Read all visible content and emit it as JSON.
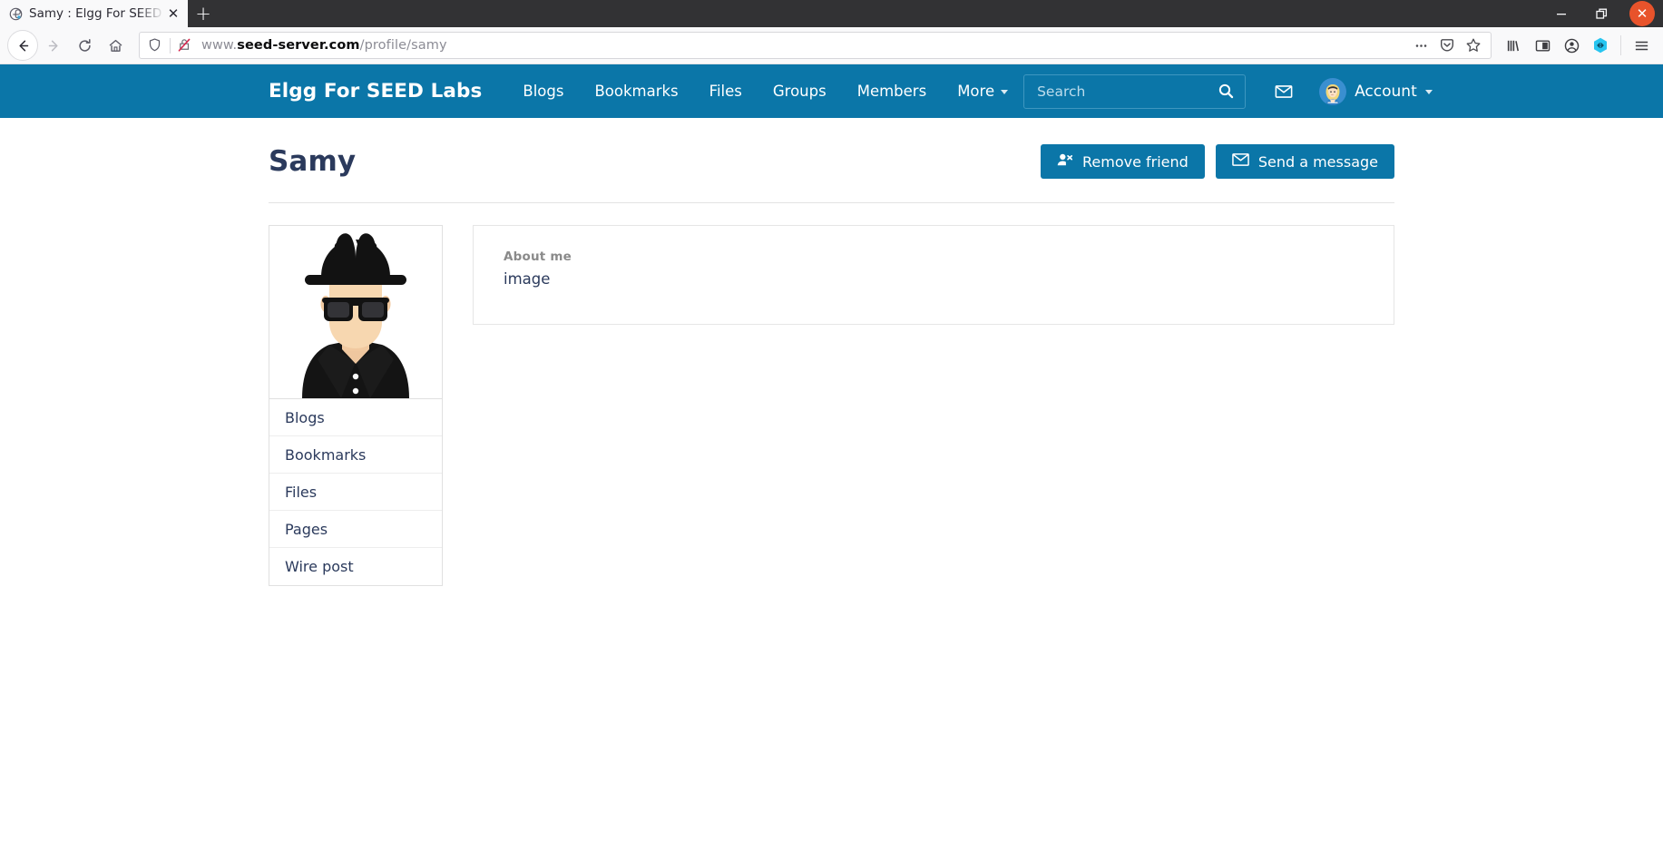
{
  "browser": {
    "tab": {
      "title": "Samy : Elgg For SEED Lab",
      "favicon_name": "elgg-favicon",
      "close_label": "✕"
    },
    "newtab_label": "+",
    "window_controls": {
      "minimize": "—",
      "maximize": "❐",
      "close": "✕"
    },
    "nav": {
      "back": "back-arrow",
      "forward": "forward-arrow",
      "reload": "reload",
      "home": "home"
    },
    "url": {
      "prefix": "www.",
      "domain": "seed-server.com",
      "path": "/profile/samy",
      "full": "www.seed-server.com/profile/samy"
    },
    "url_icons": [
      "page-actions-ellipsis",
      "pocket-save",
      "bookmark-star"
    ],
    "toolbar_icons": [
      "library",
      "sidebar",
      "account-circle",
      "container-extension",
      "app-menu"
    ]
  },
  "site": {
    "brand": "Elgg For SEED Labs",
    "nav_items": [
      {
        "label": "Blogs",
        "has_caret": false
      },
      {
        "label": "Bookmarks",
        "has_caret": false
      },
      {
        "label": "Files",
        "has_caret": false
      },
      {
        "label": "Groups",
        "has_caret": false
      },
      {
        "label": "Members",
        "has_caret": false
      },
      {
        "label": "More",
        "has_caret": true
      }
    ],
    "search": {
      "placeholder": "Search",
      "value": "",
      "button_icon": "search-icon"
    },
    "messages_icon": "envelope-icon",
    "account": {
      "label": "Account",
      "avatar_name": "alice-avatar"
    },
    "header_color": "#0b76a8"
  },
  "profile": {
    "name": "Samy",
    "actions": [
      {
        "label": "Remove friend",
        "icon": "user-remove-icon"
      },
      {
        "label": "Send a message",
        "icon": "envelope-icon"
      }
    ],
    "avatar_name": "samy-spy-avatar",
    "menu_items": [
      {
        "label": "Blogs"
      },
      {
        "label": "Bookmarks"
      },
      {
        "label": "Files"
      },
      {
        "label": "Pages"
      },
      {
        "label": "Wire post"
      }
    ],
    "about": {
      "label": "About me",
      "value": "image"
    }
  }
}
